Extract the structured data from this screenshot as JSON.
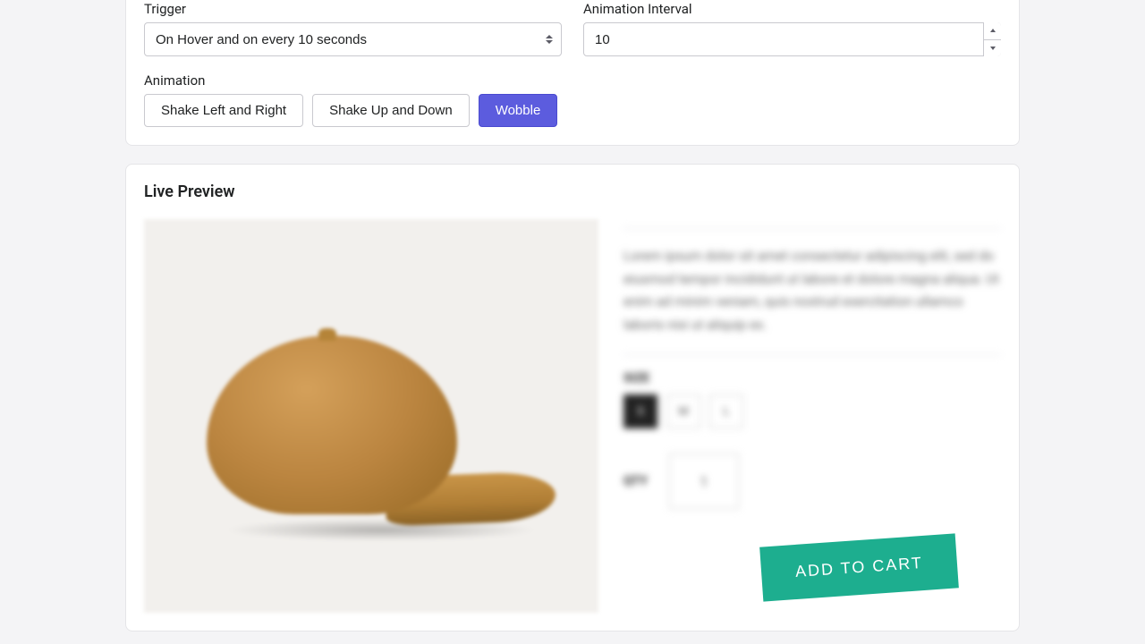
{
  "config": {
    "trigger_label": "Trigger",
    "trigger_value": "On Hover and on every 10 seconds",
    "interval_label": "Animation Interval",
    "interval_value": "10",
    "animation_label": "Animation",
    "animations": {
      "shake_lr": "Shake Left and Right",
      "shake_ud": "Shake Up and Down",
      "wobble": "Wobble"
    },
    "active_animation": "wobble"
  },
  "preview": {
    "title": "Live Preview",
    "lorem": "Lorem ipsum dolor sit amet consectetur adipiscing elit, sed do eiusmod tempor incididunt ut labore et dolore magna aliqua. Ut enim ad minim veniam, quis nostrud exercitation ullamco laboris nisi ut aliquip ex.",
    "size_label": "SIZE",
    "sizes": {
      "s": "S",
      "m": "M",
      "l": "L"
    },
    "qty_label": "QTY",
    "qty_value": "1",
    "cta": "ADD TO CART"
  }
}
